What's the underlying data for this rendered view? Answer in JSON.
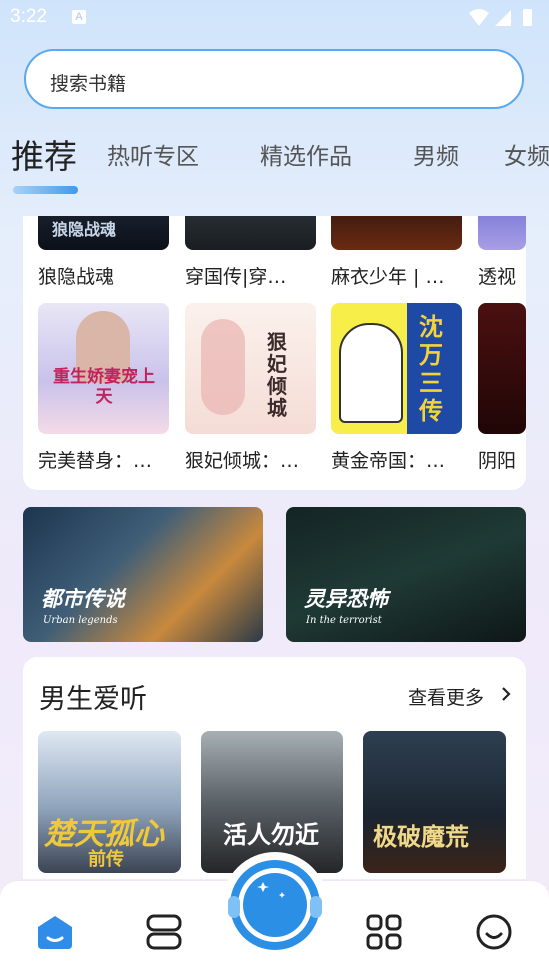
{
  "status": {
    "time": "3:22",
    "notification_badge": "A"
  },
  "search": {
    "placeholder": "搜索书籍"
  },
  "tabs": [
    "推荐",
    "热听专区",
    "精选作品",
    "男频",
    "女频"
  ],
  "grid": {
    "row1": [
      "狼隐战魂",
      "穿国传|穿…",
      "麻衣少年 | …",
      "透视"
    ],
    "row2": [
      "完美替身：…",
      "狠妃倾城：…",
      "黄金帝国：…",
      "阴阳"
    ],
    "cover_texts": {
      "c1": "狼隐战魂",
      "c5": "重生娇妻宠上天",
      "c6": "狠妃倾城",
      "c7": "沈万三传"
    }
  },
  "banners": [
    {
      "title": "都市传说",
      "subtitle": "Urban legends"
    },
    {
      "title": "灵异恐怖",
      "subtitle": "In the terrorist"
    }
  ],
  "section": {
    "title": "男生爱听",
    "more_label": "查看更多",
    "covers": [
      {
        "text": "楚天孤心",
        "sub": "前传"
      },
      {
        "text": "活人勿近"
      },
      {
        "text": "极破魔荒"
      }
    ]
  },
  "colors": {
    "accent": "#3d9aee",
    "search_border": "#5aa8ee"
  },
  "bottom_nav": [
    "home-icon",
    "bookshelf-icon",
    "player-icon",
    "category-icon",
    "profile-icon"
  ]
}
